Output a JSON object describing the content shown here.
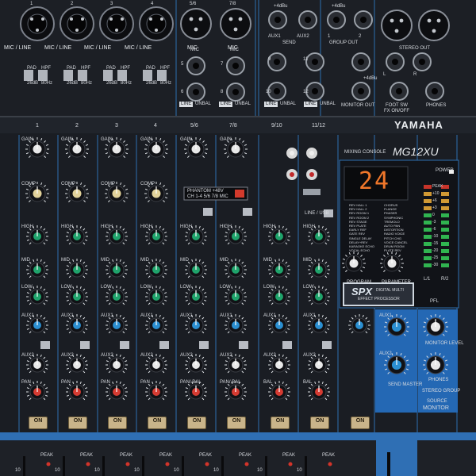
{
  "brand": "YAMAHA",
  "model": "MG12XU",
  "model_sub": "MIXING CONSOLE",
  "channels": [
    {
      "num": "1",
      "jack": "MIC / LINE",
      "strip": "1"
    },
    {
      "num": "2",
      "jack": "MIC / LINE",
      "strip": "2"
    },
    {
      "num": "3",
      "jack": "MIC / LINE",
      "strip": "3"
    },
    {
      "num": "4",
      "jack": "MIC / LINE",
      "strip": "4"
    },
    {
      "num": "5/6",
      "jack": "MIC",
      "strip": "5/6"
    },
    {
      "num": "7/8",
      "jack": "MIC",
      "strip": "7/8"
    },
    {
      "num": "",
      "jack": "",
      "strip": "9/10"
    },
    {
      "num": "",
      "jack": "",
      "strip": "11/12"
    }
  ],
  "pad_label": "PAD",
  "pad_value": "26dB",
  "hpf_label": "HPF",
  "hpf_value": "80Hz",
  "line_label": "LINE",
  "unbal_label": "UNBAL",
  "l_mono": "L/ MONO",
  "mic_label": "MIC",
  "jack_nums": {
    "five": "5",
    "six": "6",
    "seven": "7",
    "eight": "8",
    "nine": "9",
    "ten": "10",
    "eleven": "11",
    "twelve": "12"
  },
  "aux_send": {
    "aux1": "AUX1",
    "aux2": "AUX2",
    "send": "SEND",
    "db": "+4dBu"
  },
  "group_out": {
    "label": "GROUP OUT",
    "one": "1",
    "two": "2",
    "db": "+4dBu"
  },
  "stereo_out": {
    "label": "STEREO OUT",
    "l": "L",
    "r": "R"
  },
  "monitor_out": {
    "label": "MONITOR OUT",
    "db": "+4dBu"
  },
  "footsw": {
    "line1": "FOOT SW",
    "line2": "FX ON/OFF"
  },
  "phones": "PHONES",
  "knob_labels": {
    "gain": "GAIN",
    "comp": "COMP",
    "high": "HIGH",
    "mid": "MID",
    "low": "LOW",
    "aux1": "AUX1",
    "aux2": "AUX2",
    "fx": "FX",
    "pan": "PAN",
    "pan_bal": "PAN/ BAL",
    "bal": "BAL",
    "pre": "PRE"
  },
  "phantom": {
    "line1": "PHANTOM +48V",
    "line2": "CH 1-4 5/6 7/8 MIC"
  },
  "line_usb": "LINE / USB",
  "on_label": "ON",
  "peak_label": "PEAK",
  "fx_display": "24",
  "power_label": "POWER",
  "spx": {
    "logo": "SPX",
    "line1": "DIGITAL MULTI",
    "line2": "EFFECT PROCESSOR"
  },
  "program_label": "PROGRAM",
  "parameter_label": "PARAMETER",
  "fx_programs_left": [
    "REV HALL 1",
    "REV HALL 2",
    "REV ROOM 1",
    "REV ROOM 2",
    "REV STAGE",
    "REV PLATE",
    "EARLY REF",
    "GATE REV",
    "SINGLE DELAY",
    "DELAY+REV",
    "KARAOKE ECHO",
    "VOCAL ECHO"
  ],
  "fx_programs_right": [
    "CHORUS",
    "FLANGE",
    "PHASER",
    "SYMPHONIC",
    "TREMOLO",
    "AUTO PAN",
    "DISTORTION",
    "RADIO VOICE",
    "PITCH CHG",
    "VOICE CANCEL",
    "DRUM ROOM",
    "PLATE REV"
  ],
  "meter_scale": [
    "PEAK",
    "+10",
    "+6",
    "+3",
    "0",
    "-3",
    "-6",
    "-10",
    "-15",
    "-20",
    "-25",
    "-30"
  ],
  "meter_lr": {
    "l": "L/1",
    "r": "R/2"
  },
  "pfl": "PFL",
  "master": {
    "aux1": "AUX1",
    "aux2": "AUX2",
    "send_master": "SEND MASTER",
    "monitor_level": "MONITOR LEVEL",
    "phones": "PHONES",
    "stereo_group": "STEREO GROUP",
    "source": "SOURCE",
    "monitor": "MONITOR"
  },
  "fader_marks": [
    "10",
    "5"
  ]
}
